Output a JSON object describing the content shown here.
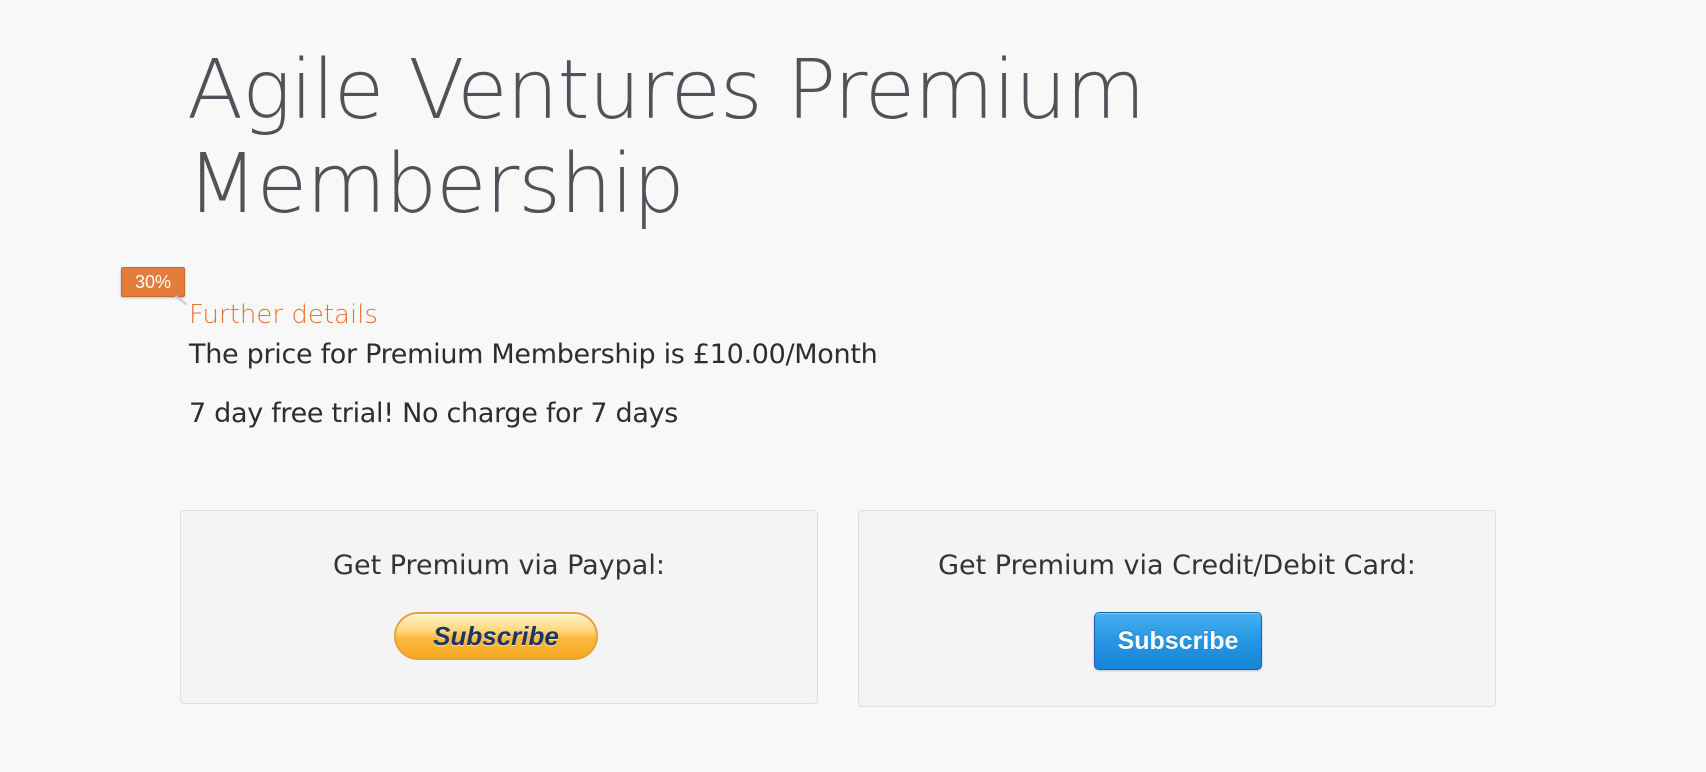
{
  "page": {
    "title": "Agile Ventures Premium Membership"
  },
  "progress_badge": {
    "label": "30%",
    "value_percent": 30
  },
  "details": {
    "heading": "Further details",
    "price": "The price for Premium Membership is £10.00/Month",
    "trial": "7 day free trial! No charge for 7 days"
  },
  "payment_options": {
    "paypal": {
      "heading": "Get Premium via Paypal:",
      "button_label": "Subscribe"
    },
    "card": {
      "heading": "Get Premium via Credit/Debit Card:",
      "button_label": "Subscribe"
    }
  },
  "colors": {
    "accent": "#e8712f",
    "badge": "#e47d3b",
    "title": "#505159",
    "card_button": "#2696e3",
    "paypal_button": "#fcb942"
  }
}
